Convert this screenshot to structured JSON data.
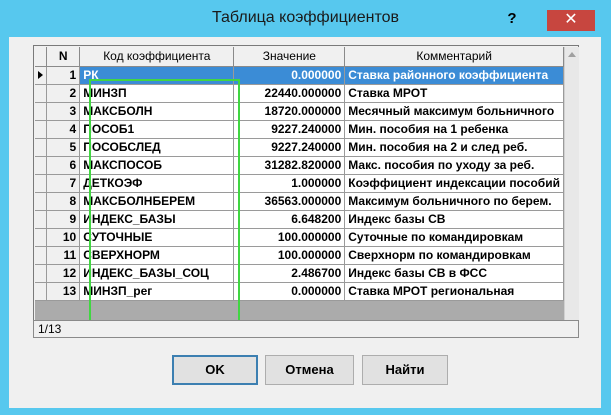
{
  "window": {
    "title": "Таблица коэффициентов",
    "help_label": "?",
    "close_label": "✕"
  },
  "grid": {
    "columns": [
      "N",
      "Код коэффициента",
      "Значение",
      "Комментарий"
    ],
    "rows": [
      {
        "n": "1",
        "code": "РК",
        "value": "0.000000",
        "comment": "Ставка районного коэффициента"
      },
      {
        "n": "2",
        "code": "МИНЗП",
        "value": "22440.000000",
        "comment": "Ставка МРОТ"
      },
      {
        "n": "3",
        "code": "МАКСБОЛН",
        "value": "18720.000000",
        "comment": "Месячный максимум больничного"
      },
      {
        "n": "4",
        "code": "ПОСОБ1",
        "value": "9227.240000",
        "comment": "Мин. пособия на 1 ребенка"
      },
      {
        "n": "5",
        "code": "ПОСОБСЛЕД",
        "value": "9227.240000",
        "comment": "Мин. пособия на 2 и след реб."
      },
      {
        "n": "6",
        "code": "МАКСПОСОБ",
        "value": "31282.820000",
        "comment": "Макс. пособия по уходу за реб."
      },
      {
        "n": "7",
        "code": "ДЕТКОЭФ",
        "value": "1.000000",
        "comment": "Коэффициент индексации пособий"
      },
      {
        "n": "8",
        "code": "МАКСБОЛНБЕРЕМ",
        "value": "36563.000000",
        "comment": "Максимум больничного по берем."
      },
      {
        "n": "9",
        "code": "ИНДЕКС_БАЗЫ",
        "value": "6.648200",
        "comment": "Индекс базы СВ"
      },
      {
        "n": "10",
        "code": "СУТОЧНЫЕ",
        "value": "100.000000",
        "comment": "Суточные по командировкам"
      },
      {
        "n": "11",
        "code": "СВЕРХНОРМ",
        "value": "100.000000",
        "comment": "Сверхнорм по командировкам"
      },
      {
        "n": "12",
        "code": "ИНДЕКС_БАЗЫ_СОЦ",
        "value": "2.486700",
        "comment": "Индекс базы СВ в ФСС"
      },
      {
        "n": "13",
        "code": "МИНЗП_рег",
        "value": "0.000000",
        "comment": "Ставка МРОТ региональная"
      }
    ],
    "selected_row": 1
  },
  "status": {
    "position": "1/13"
  },
  "buttons": {
    "ok": "OK",
    "cancel": "Отмена",
    "find": "Найти"
  },
  "colors": {
    "titlebar": "#57c8ee",
    "selection": "#3b8cd6",
    "highlight_frame": "#41d642",
    "close_button": "#c7463f"
  }
}
